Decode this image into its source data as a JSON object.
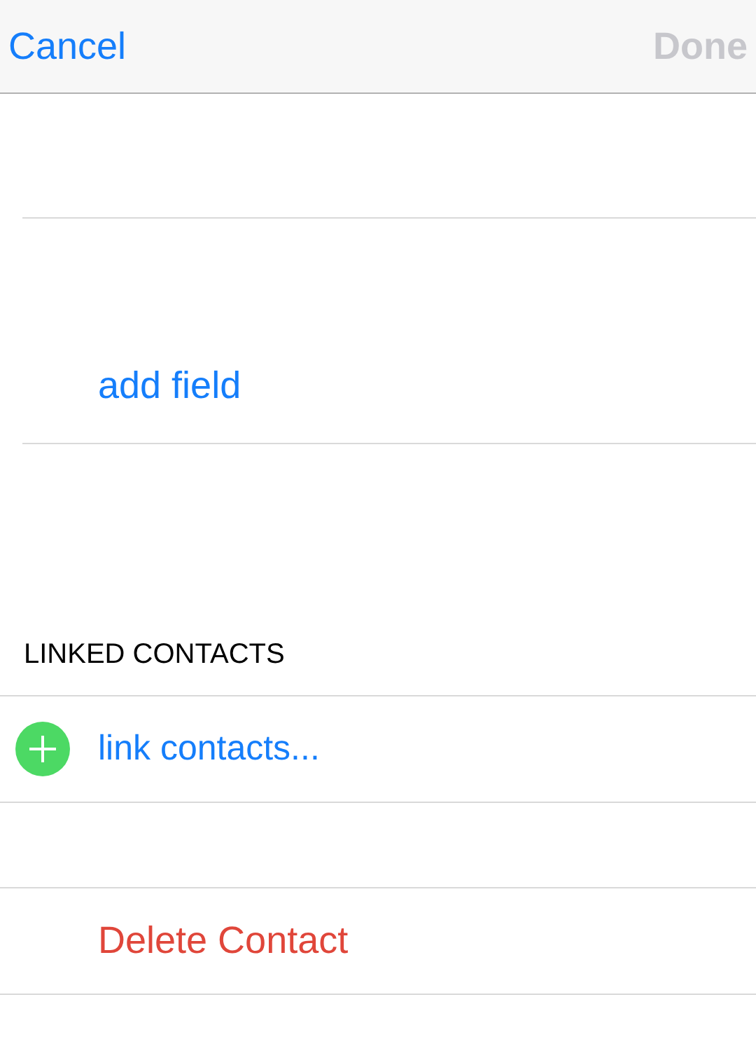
{
  "nav_bar": {
    "cancel": "Cancel",
    "done": {
      "label": "Done",
      "disabled": true
    }
  },
  "add_field": "add field",
  "linked_contacts": {
    "header": "LINKED CONTACTS",
    "link": "link contacts..."
  },
  "delete": "Delete Contact"
}
